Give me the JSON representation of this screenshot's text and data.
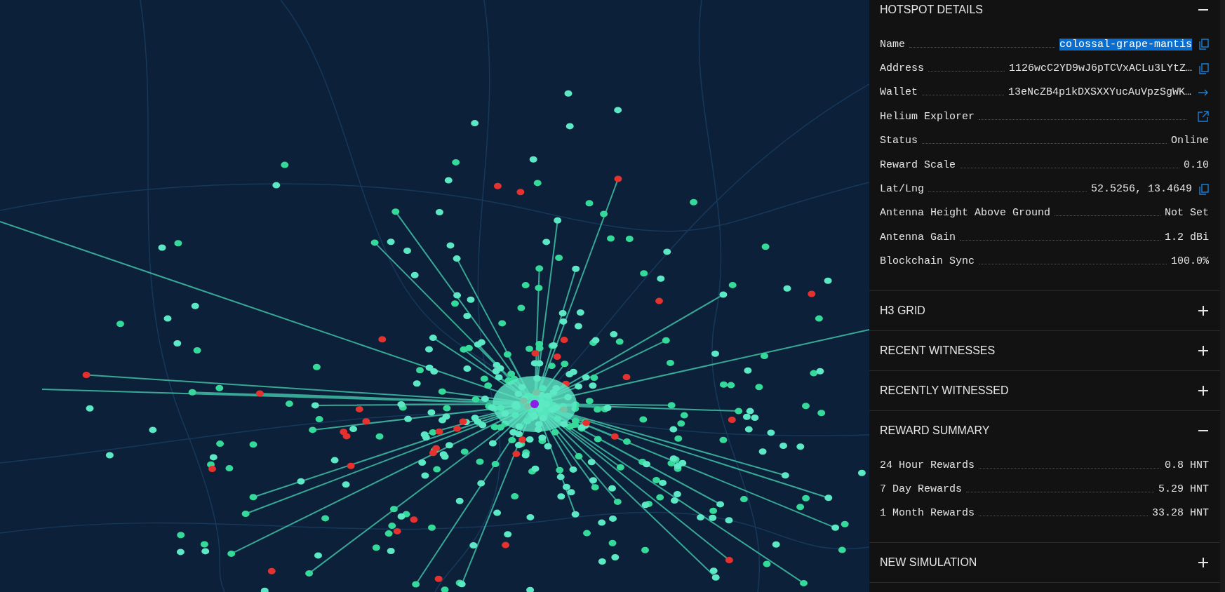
{
  "sections": [
    {
      "title": "HOTSPOT DETAILS",
      "expanded": true,
      "rows": [
        {
          "label": "Name",
          "value": "colossal-grape-mantis",
          "kind": "copy",
          "highlighted": true
        },
        {
          "label": "Address",
          "value": "1126wcC2YD9wJ6pTCVxACLu3LYtZ…",
          "kind": "copy",
          "highlighted": false
        },
        {
          "label": "Wallet",
          "value": "13eNcZB4p1kDXSXXYucAuVpzSgWK…",
          "kind": "link",
          "highlighted": false
        },
        {
          "label": "Helium Explorer",
          "kind": "external",
          "highlighted": false
        },
        {
          "label": "Status",
          "value": "Online",
          "kind": "plain",
          "highlighted": false
        },
        {
          "label": "Reward Scale",
          "value": "0.10",
          "kind": "plain",
          "highlighted": false
        },
        {
          "label": "Lat/Lng",
          "value": "52.5256, 13.4649",
          "kind": "copy",
          "highlighted": false
        },
        {
          "label": "Antenna Height Above Ground",
          "value": "Not Set",
          "kind": "plain",
          "highlighted": false
        },
        {
          "label": "Antenna Gain",
          "value": "1.2 dBi",
          "kind": "plain",
          "highlighted": false
        },
        {
          "label": "Blockchain Sync",
          "value": "100.0%",
          "kind": "plain",
          "highlighted": false
        }
      ]
    },
    {
      "title": "H3 GRID",
      "expanded": false
    },
    {
      "title": "RECENT WITNESSES",
      "expanded": false
    },
    {
      "title": "RECENTLY WITNESSED",
      "expanded": false
    },
    {
      "title": "REWARD SUMMARY",
      "expanded": true,
      "rows": [
        {
          "label": "24 Hour Rewards",
          "value": "0.8 HNT",
          "kind": "plain",
          "highlighted": false
        },
        {
          "label": "7 Day Rewards",
          "value": "5.29 HNT",
          "kind": "plain",
          "highlighted": false
        },
        {
          "label": "1 Month Rewards",
          "value": "33.28 HNT",
          "kind": "plain",
          "highlighted": false
        }
      ]
    },
    {
      "title": "NEW SIMULATION",
      "expanded": false
    }
  ]
}
